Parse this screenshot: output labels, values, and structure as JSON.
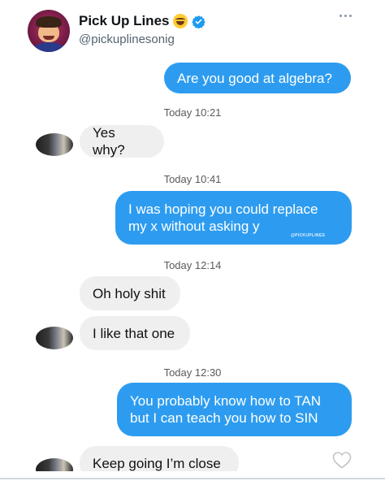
{
  "tweet": {
    "display_name": "Pick Up Lines",
    "handle": "@pickuplinesonig",
    "avatar_icon": "profile-avatar",
    "emoji_icon": "rolling-on-floor-laughing-emoji",
    "verified_icon": "verified-badge",
    "verified_color": "#1d9bf0",
    "more_icon": "more-options-icon"
  },
  "chat": {
    "colors": {
      "outgoing": "#2d9cf0",
      "incoming": "#efefef"
    },
    "messages": [
      {
        "type": "out",
        "text": "Are you good at algebra?"
      },
      {
        "type": "time",
        "text": "Today 10:21"
      },
      {
        "type": "in",
        "text": "Yes why?"
      },
      {
        "type": "time",
        "text": "Today 10:41"
      },
      {
        "type": "out",
        "lines": [
          "I was hoping you could replace",
          "my x without asking y"
        ],
        "watermark": "@PICKUPLINES"
      },
      {
        "type": "time",
        "text": "Today 12:14"
      },
      {
        "type": "in",
        "text": "Oh holy shit"
      },
      {
        "type": "in",
        "text": "I like that one"
      },
      {
        "type": "time",
        "text": "Today 12:30"
      },
      {
        "type": "out",
        "lines": [
          "You probably know how to TAN",
          "but I can teach you how to SIN"
        ]
      },
      {
        "type": "in",
        "text": "Keep going I’m close"
      }
    ],
    "like_icon": "heart-outline-icon"
  }
}
